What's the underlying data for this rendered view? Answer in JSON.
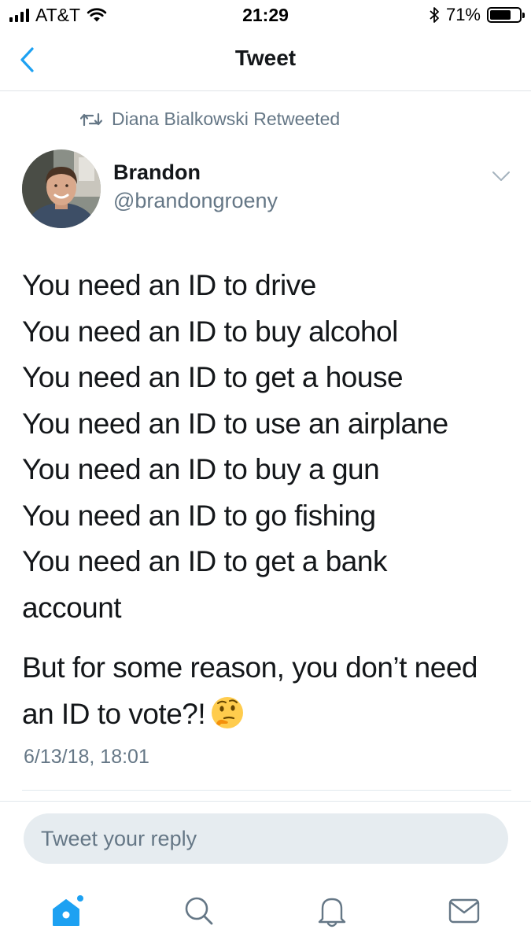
{
  "status_bar": {
    "carrier": "AT&T",
    "time": "21:29",
    "battery_percent": "71%",
    "battery_level": 0.71,
    "signal_bars": 4
  },
  "nav": {
    "title": "Tweet"
  },
  "retweet_context": {
    "text": "Diana Bialkowski Retweeted"
  },
  "author": {
    "name": "Brandon",
    "handle": "@brandongroeny"
  },
  "tweet": {
    "lines": [
      "You need an ID to drive",
      "You need an ID to buy alcohol",
      "You need an ID to get a house",
      "You need an ID to use an airplane",
      "You need an ID to buy a gun",
      "You need an ID to go fishing",
      "You need an ID to get a bank account"
    ],
    "paragraph2": "But for some reason, you don’t need an ID to vote?!",
    "emoji": "thinking-face",
    "timestamp": "6/13/18, 18:01"
  },
  "reply": {
    "placeholder": "Tweet your reply"
  },
  "tab_bar": {
    "items": [
      "home-icon",
      "search-icon",
      "notifications-icon",
      "messages-icon"
    ],
    "active": "home-icon"
  },
  "colors": {
    "accent": "#1da1f2",
    "text_primary": "#14171a",
    "text_secondary": "#657786",
    "divider": "#e1e8ed",
    "reply_bg": "#e6ecf0"
  }
}
